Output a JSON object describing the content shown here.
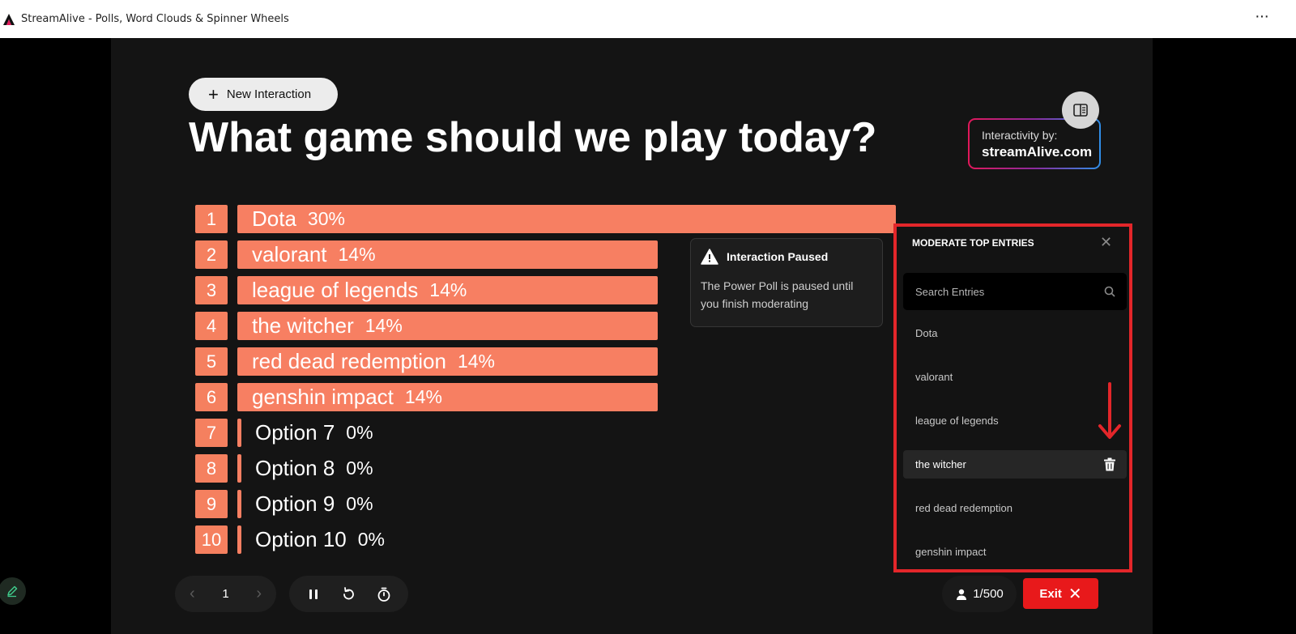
{
  "window": {
    "title": "StreamAlive - Polls, Word Clouds & Spinner Wheels",
    "more_icon": "ellipsis-icon"
  },
  "toolbar": {
    "new_interaction_label": "New Interaction"
  },
  "poll": {
    "question": "What game should we play today?",
    "options": [
      {
        "rank": "1",
        "name": "Dota",
        "percent": "30%",
        "share": 30
      },
      {
        "rank": "2",
        "name": "valorant",
        "percent": "14%",
        "share": 14
      },
      {
        "rank": "3",
        "name": "league of legends",
        "percent": "14%",
        "share": 14
      },
      {
        "rank": "4",
        "name": "the witcher",
        "percent": "14%",
        "share": 14
      },
      {
        "rank": "5",
        "name": "red dead redemption",
        "percent": "14%",
        "share": 14
      },
      {
        "rank": "6",
        "name": "genshin impact",
        "percent": "14%",
        "share": 14
      },
      {
        "rank": "7",
        "name": "Option 7",
        "percent": "0%",
        "share": 0
      },
      {
        "rank": "8",
        "name": "Option 8",
        "percent": "0%",
        "share": 0
      },
      {
        "rank": "9",
        "name": "Option 9",
        "percent": "0%",
        "share": 0
      },
      {
        "rank": "10",
        "name": "Option 10",
        "percent": "0%",
        "share": 0
      }
    ],
    "bar_color": "#f77f62"
  },
  "branding": {
    "by_label": "Interactivity by:",
    "name": "streamAlive.com"
  },
  "paused": {
    "title": "Interaction Paused",
    "message": "The Power Poll is paused until you finish moderating"
  },
  "moderation": {
    "title": "MODERATE TOP ENTRIES",
    "search_placeholder": "Search Entries",
    "entries": [
      "Dota",
      "valorant",
      "league of legends",
      "the witcher",
      "red dead redemption",
      "genshin impact"
    ],
    "hovered_entry": "the witcher",
    "highlight_color": "#e3262a"
  },
  "footer": {
    "page": "1",
    "users": "1/500",
    "exit_label": "Exit"
  },
  "colors": {
    "accent": "#f77f62",
    "exit": "#e8191b",
    "background": "#141414"
  }
}
